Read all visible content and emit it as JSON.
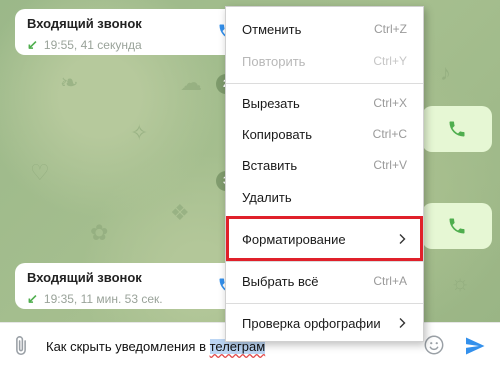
{
  "chat": {
    "calls": [
      {
        "title": "Входящий звонок",
        "meta": "19:55, 41 секунда"
      },
      {
        "title": "Входящий звонок",
        "meta": "19:35, 11 мин. 53 сек."
      }
    ],
    "date_pills": [
      "2",
      "3"
    ]
  },
  "composer": {
    "text_before": "Как скрыть уведомления в ",
    "text_selected": "телеграм"
  },
  "context_menu": {
    "items": [
      {
        "label": "Отменить",
        "shortcut": "Ctrl+Z"
      },
      {
        "label": "Повторить",
        "shortcut": "Ctrl+Y"
      },
      {
        "label": "Вырезать",
        "shortcut": "Ctrl+X"
      },
      {
        "label": "Копировать",
        "shortcut": "Ctrl+C"
      },
      {
        "label": "Вставить",
        "shortcut": "Ctrl+V"
      },
      {
        "label": "Удалить",
        "shortcut": ""
      },
      {
        "label": "Форматирование",
        "shortcut": ""
      },
      {
        "label": "Выбрать всё",
        "shortcut": "Ctrl+A"
      },
      {
        "label": "Проверка орфографии",
        "shortcut": ""
      }
    ]
  },
  "colors": {
    "accent": "#3390ec",
    "call_green": "#4fae4e",
    "highlight_red": "#e0202a",
    "outgoing_bubble": "#e6f7d4"
  },
  "icons": {
    "attach": "paperclip-icon",
    "emoji": "smile-icon",
    "send": "send-icon",
    "call": "phone-icon",
    "call_direction": "incoming-arrow-icon",
    "submenu": "chevron-right-icon"
  }
}
